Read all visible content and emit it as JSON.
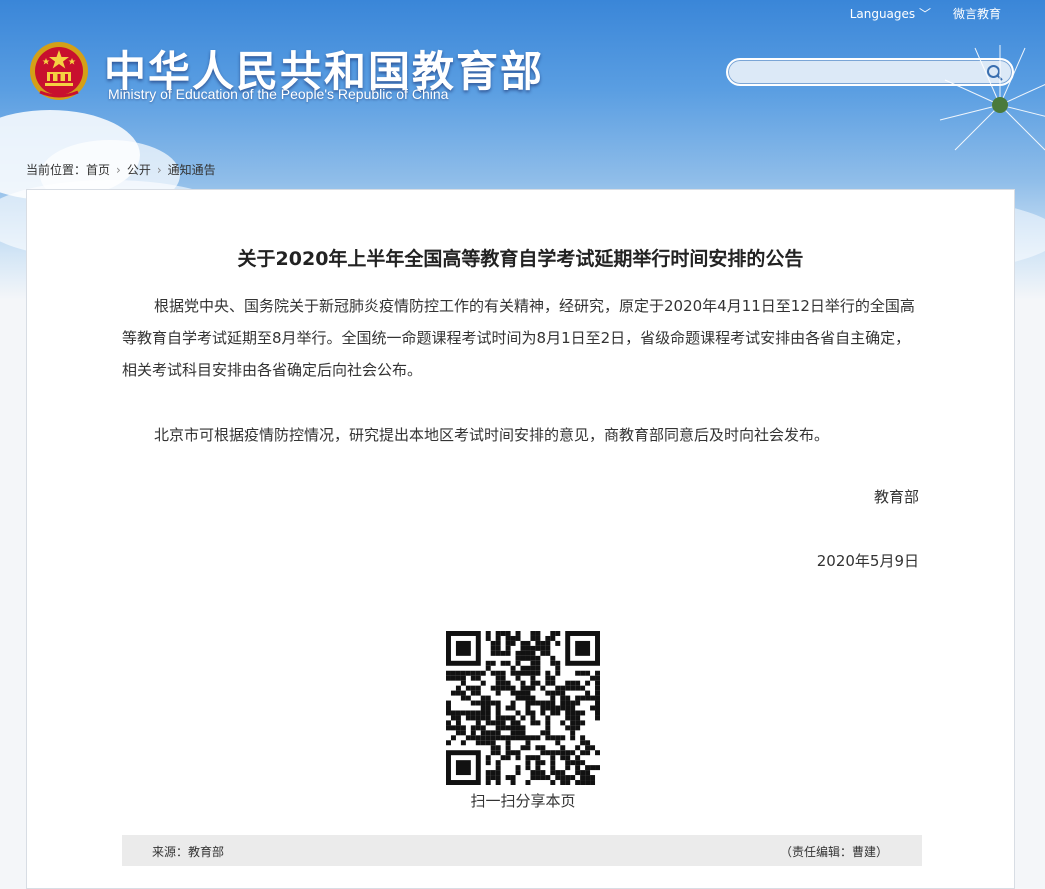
{
  "topnav": {
    "languages": "Languages ﹀",
    "weibo": "微言教育"
  },
  "site": {
    "title_cn": "中华人民共和国教育部",
    "title_en": "Ministry of Education of the People's Republic of China",
    "emblem_icon": "national-emblem-icon"
  },
  "search": {
    "placeholder": "",
    "icon": "search-icon"
  },
  "breadcrumb": {
    "label": "当前位置：",
    "items": [
      "首页",
      "公开",
      "通知通告"
    ]
  },
  "article": {
    "title": "关于2020年上半年全国高等教育自学考试延期举行时间安排的公告",
    "p1": "根据党中央、国务院关于新冠肺炎疫情防控工作的有关精神，经研究，原定于2020年4月11日至12日举行的全国高等教育自学考试延期至8月举行。全国统一命题课程考试时间为8月1日至2日，省级命题课程考试安排由各省自主确定，相关考试科目安排由各省确定后向社会公布。",
    "p2": "北京市可根据疫情防控情况，研究提出本地区考试时间安排的意见，商教育部同意后及时向社会发布。",
    "signer": "教育部",
    "date": "2020年5月9日"
  },
  "share": {
    "qr_label": "扫一扫分享本页"
  },
  "footer": {
    "source": "来源：教育部",
    "editor": "（责任编辑：曹建）"
  },
  "colors": {
    "sky": "#3a86d8",
    "card_border": "#d8dde4",
    "footer_bg": "#ebebeb"
  }
}
